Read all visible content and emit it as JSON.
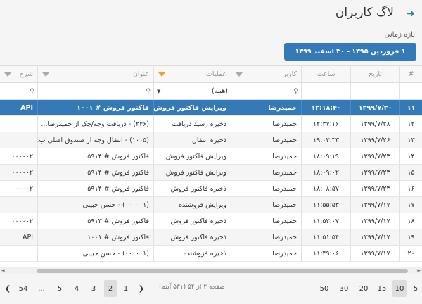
{
  "header": {
    "title": "لاگ کاربران",
    "back_icon": "arrow-right-icon"
  },
  "period": {
    "label": "بازه زمانی",
    "value": "۱ فروردین ۱۳۹۵ - ۳۰ اسفند ۱۳۹۹"
  },
  "columns": {
    "idx": "#",
    "date": "تاریخ",
    "time": "ساعت",
    "user": "کاربر",
    "operation": "عملیات",
    "title": "عنوان",
    "description": "شرح"
  },
  "filters": {
    "operation_select": "(همه)"
  },
  "rows": [
    {
      "idx": "۱۱",
      "date": "۱۳۹۹/۷/۳۰",
      "time": "۱۳:۱۸:۴۰",
      "user": "حمیدرضا",
      "operation": "ویرایش فاکتور فروش",
      "title": "فاکتور فروش # ۱۰۰۱",
      "description": "API"
    },
    {
      "idx": "۱۲",
      "date": "۱۳۹۹/۷/۲۸",
      "time": "۱۲:۳۷:۱۶",
      "user": "حمیدرضا",
      "operation": "ذخیره رسید دریافت",
      "title": "(۲۴۶) - دریافت وجه/چک از حمیدرضا...",
      "description": ""
    },
    {
      "idx": "۱۳",
      "date": "۱۳۹۹/۷/۲۶",
      "time": "۱۹:۰۳:۳۳",
      "user": "حمیدرضا",
      "operation": "ذخیره انتقال",
      "title": "(۱۰۰۵) - انتقال وجه از صندوق اصلی ب...",
      "description": ""
    },
    {
      "idx": "۱۴",
      "date": "۱۳۹۹/۷/۲۳",
      "time": "۱۸:۰۹:۱۹",
      "user": "حمیدرضا",
      "operation": "ویرایش فاکتور فروش",
      "title": "فاکتور فروش # ۵۹۱۴",
      "description": "۰۰۰۰۰۲"
    },
    {
      "idx": "۱۵",
      "date": "۱۳۹۹/۷/۲۳",
      "time": "۱۸:۰۹:۰۲",
      "user": "حمیدرضا",
      "operation": "ویرایش فاکتور فروش",
      "title": "فاکتور فروش # ۵۹۱۴",
      "description": "۰۰۰۰۰۲"
    },
    {
      "idx": "۱۶",
      "date": "۱۳۹۹/۷/۲۳",
      "time": "۱۸:۰۸:۵۷",
      "user": "حمیدرضا",
      "operation": "ذخیره فاکتور فروش",
      "title": "فاکتور فروش # ۵۹۱۴",
      "description": "۰۰۰۰۰۲"
    },
    {
      "idx": "۱۷",
      "date": "۱۳۹۹/۷/۱۷",
      "time": "۱۱:۵۵:۵۳",
      "user": "حمیدرضا",
      "operation": "ویرایش فروشنده",
      "title": "(۰۰۰۰۰۱) - حسن حبیبی",
      "description": ""
    },
    {
      "idx": "۱۸",
      "date": "۱۳۹۹/۷/۱۷",
      "time": "۱۱:۵۳:۰۷",
      "user": "حمیدرضا",
      "operation": "ذخیره فاکتور فروش",
      "title": "فاکتور فروش # ۵۹۱۳",
      "description": "۰۰۰۰۰۲"
    },
    {
      "idx": "۱۹",
      "date": "۱۳۹۹/۷/۱۷",
      "time": "۱۱:۵۱:۵۴",
      "user": "حمیدرضا",
      "operation": "ذخیره فاکتور فروش",
      "title": "فاکتور فروش # ۱۰۰۱",
      "description": "API"
    },
    {
      "idx": "۲۰",
      "date": "۱۳۹۹/۷/۱۷",
      "time": "۱۱:۴۹:۰۶",
      "user": "حمیدرضا",
      "operation": "ذخیره فروشنده",
      "title": "(۰۰۰۰۰۱) - حسن حبیبی",
      "description": ""
    }
  ],
  "selected_row": 0,
  "pager": {
    "info": "صفحه ۲ از ۵۴ (۵۳۱ آیتم)",
    "page_sizes": [
      "5",
      "10",
      "15",
      "20",
      "30",
      "50"
    ],
    "active_page_size": "10",
    "pages": [
      "1",
      "2",
      "3",
      "4",
      "5",
      "...",
      "54"
    ],
    "active_page": "2"
  }
}
